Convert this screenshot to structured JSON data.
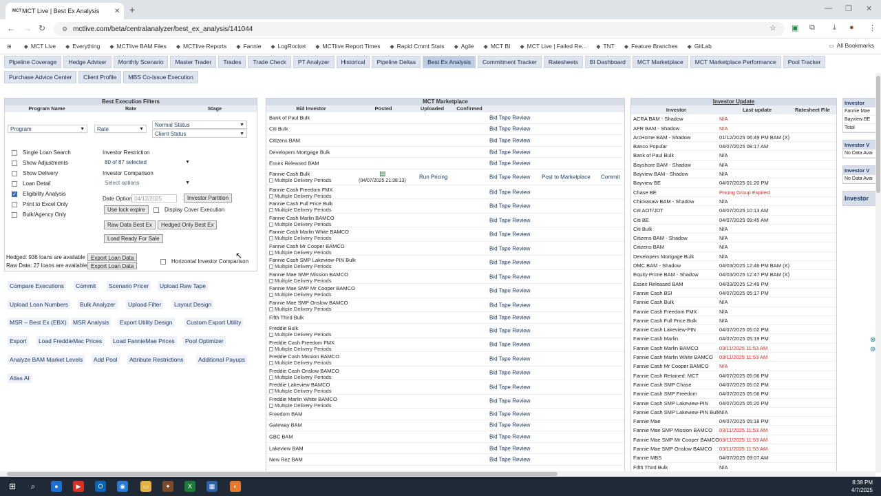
{
  "browser": {
    "tab_title": "MCT Live | Best Ex Analysis",
    "tab_favicon": "MCT",
    "url": "mctlive.com/beta/centralanalyzer/best_ex_analysis/141044",
    "all_bookmarks": "All Bookmarks"
  },
  "bookmarks": [
    {
      "label": "MCT Live",
      "icon": "mct-icon"
    },
    {
      "label": "Everything",
      "icon": "cart-icon"
    },
    {
      "label": "MCTlive BAM Files",
      "icon": "gdrive-icon"
    },
    {
      "label": "MCTlive Reports",
      "icon": "github-icon"
    },
    {
      "label": "Fannie",
      "icon": "globe-icon"
    },
    {
      "label": "LogRocket",
      "icon": "logrocket-icon"
    },
    {
      "label": "MCTlive Report Times",
      "icon": "mct-icon"
    },
    {
      "label": "Rapid Cmmt Stats",
      "icon": "mct-icon"
    },
    {
      "label": "Agile",
      "icon": "github-icon"
    },
    {
      "label": "MCT BI",
      "icon": "bi-icon"
    },
    {
      "label": "MCT Live | Failed Re...",
      "icon": "mct-icon"
    },
    {
      "label": "TNT",
      "icon": "tnt-icon"
    },
    {
      "label": "Feature Branches",
      "icon": "folder-icon"
    },
    {
      "label": "GitLab",
      "icon": "gitlab-icon"
    }
  ],
  "nav": {
    "row1": [
      "Pipeline Coverage",
      "Hedge Adviser",
      "Monthly Scenario",
      "Master Trader",
      "Trades",
      "Trade Check",
      "PT Analyzer",
      "Historical",
      "Pipeline Deltas",
      "Best Ex Analysis",
      "Commitment Tracker",
      "Ratesheets",
      "BI Dashboard",
      "MCT Marketplace",
      "MCT Marketplace Performance",
      "Pool Tracker"
    ],
    "row2": [
      "Purchase Advice Center",
      "Client Profile",
      "MBS Co-Issue Execution"
    ],
    "active": "Best Ex Analysis"
  },
  "filters": {
    "title": "Best Execution Filters",
    "columns": [
      "Program Name",
      "Rate",
      "Stage"
    ],
    "program": "Program",
    "rate": "Rate",
    "stage1": "Normal Status",
    "stage2": "Client Status",
    "checkboxes": [
      {
        "label": "Single Loan Search",
        "checked": false
      },
      {
        "label": "Show Adjustments",
        "checked": false
      },
      {
        "label": "Show Delivery",
        "checked": false
      },
      {
        "label": "Loan Detail",
        "checked": false
      },
      {
        "label": "Eligibility Analysis",
        "checked": true
      },
      {
        "label": "Print to Excel Only",
        "checked": false
      },
      {
        "label": "Bulk/Agency Only",
        "checked": false
      }
    ],
    "investor_restriction_label": "Investor Restriction",
    "investor_restriction_value": "80 of 87 selected",
    "investor_comparison_label": "Investor Comparison",
    "investor_comparison_placeholder": "Select options",
    "date_option_label": "Date Option",
    "date_value": "04/12/2025",
    "investor_partition": "Investor Partition",
    "use_lock_expire": "Use lock expire",
    "display_cover_execution": "Display Cover Execution",
    "raw_data_best_ex": "Raw Data Best Ex",
    "hedged_only_best_ex": "Hedged Only Best Ex",
    "load_ready_for_sale": "Load Ready For Sale",
    "hedged_text": "Hedged: 936 loans are available",
    "raw_text": "Raw Data: 27 loans are available",
    "export_loan_data": "Export Loan Data",
    "horizontal_comparison": "Horizontal Investor Comparison"
  },
  "actions": [
    [
      "Compare Executions",
      "Commit",
      "Scenario Pricer",
      "Upload Raw Tape"
    ],
    [
      "Upload Loan Numbers",
      "Bulk Analyzer",
      "Upload Filter",
      "Layout Design"
    ],
    [
      "MSR – Best Ex (EBX)",
      "MSR Analysis",
      "Export Utility Design",
      "Custom Export Utility"
    ],
    [
      "Export",
      "Load FreddieMac Prices",
      "Load FannieMae Prices",
      "Pool Optimizer"
    ],
    [
      "Analyze BAM Market Levels",
      "Add Pool",
      "Attribute Restrictions",
      "Additional Payups"
    ],
    [
      "Atlas AI"
    ]
  ],
  "marketplace": {
    "title": "MCT Marketplace",
    "columns": [
      "Bid Investor",
      "Posted",
      "Uploaded",
      "Confirmed"
    ],
    "review_label": "Bid Tape Review",
    "multi_label": "Multiple Delivery Periods",
    "run_pricing": "Run Pricing",
    "post_to_marketplace": "Post to Marketplace",
    "commit": "Commit",
    "uploaded_time": "(04/07/2025 21:38:13)",
    "rows": [
      {
        "name": "Bank of Paul Bulk",
        "multi": false
      },
      {
        "name": "Citi Bulk",
        "multi": false
      },
      {
        "name": "Citizens BAM",
        "multi": false
      },
      {
        "name": "Developers Mortgage Bulk",
        "multi": false
      },
      {
        "name": "Essex Released BAM",
        "multi": false
      },
      {
        "name": "Fannie Cash Bulk",
        "multi": true,
        "special": true
      },
      {
        "name": "Fannie Cash Freedom FMX",
        "multi": true
      },
      {
        "name": "Fannie Cash Full Price Bulk",
        "multi": true
      },
      {
        "name": "Fannie Cash Marlin BAMCO",
        "multi": true
      },
      {
        "name": "Fannie Cash Marlin White BAMCO",
        "multi": true
      },
      {
        "name": "Fannie Cash Mr Cooper BAMCO",
        "multi": true
      },
      {
        "name": "Fannie Cash SMP Lakeview-PIN Bulk",
        "multi": true
      },
      {
        "name": "Fannie Mae SMP Mission BAMCO",
        "multi": true
      },
      {
        "name": "Fannie Mae SMP Mr Cooper BAMCO",
        "multi": true
      },
      {
        "name": "Fannie Mae SMP Onslow BAMCO",
        "multi": true
      },
      {
        "name": "Fifth Third Bulk",
        "multi": false
      },
      {
        "name": "Freddie Bulk",
        "multi": true
      },
      {
        "name": "Freddie Cash Freedom FMX",
        "multi": true
      },
      {
        "name": "Freddie Cash Mission BAMCO",
        "multi": true
      },
      {
        "name": "Freddie Cash Onslow BAMCO",
        "multi": true
      },
      {
        "name": "Freddie Lakeview BAMCO",
        "multi": true
      },
      {
        "name": "Freddie Marlin White BAMCO",
        "multi": true
      },
      {
        "name": "Freedom BAM",
        "multi": false
      },
      {
        "name": "Gateway BAM",
        "multi": false
      },
      {
        "name": "GBC BAM",
        "multi": false
      },
      {
        "name": "Lakeview BAM",
        "multi": false
      },
      {
        "name": "New Rez BAM",
        "multi": false
      }
    ]
  },
  "investor_update": {
    "title": "Investor Update",
    "columns": [
      "Investor",
      "Last update",
      "Ratesheet File"
    ],
    "rows": [
      {
        "inv": "ACRA BAM - Shadow",
        "upd": "N/A",
        "red": true
      },
      {
        "inv": "AFR BAM - Shadow",
        "upd": "N/A",
        "red": true
      },
      {
        "inv": "ArcHome BAM - Shadow",
        "upd": "01/12/2025 06:49 PM BAM (X)",
        "red": false
      },
      {
        "inv": "Banco Popular",
        "upd": "04/07/2025 08:17 AM",
        "red": false
      },
      {
        "inv": "Bank of Paul Bulk",
        "upd": "N/A",
        "red": false
      },
      {
        "inv": "Bayshore BAM - Shadow",
        "upd": "N/A",
        "red": false
      },
      {
        "inv": "Bayview BAM - Shadow",
        "upd": "N/A",
        "red": false
      },
      {
        "inv": "Bayview BE",
        "upd": "04/07/2025 01:20 PM",
        "red": false
      },
      {
        "inv": "Chase BE",
        "upd": "Pricing Group Expired",
        "red": true
      },
      {
        "inv": "Chickasaw BAM - Shadow",
        "upd": "N/A",
        "red": false
      },
      {
        "inv": "Citi AOT/JDT",
        "upd": "04/07/2025 10:13 AM",
        "red": false
      },
      {
        "inv": "Citi BE",
        "upd": "04/07/2025 09:45 AM",
        "red": false
      },
      {
        "inv": "Citi Bulk",
        "upd": "N/A",
        "red": false
      },
      {
        "inv": "Citizens BAM - Shadow",
        "upd": "N/A",
        "red": false
      },
      {
        "inv": "Citizens BAM",
        "upd": "N/A",
        "red": false
      },
      {
        "inv": "Developers Mortgage Bulk",
        "upd": "N/A",
        "red": false
      },
      {
        "inv": "DMC BAM - Shadow",
        "upd": "04/03/2025 12:46 PM BAM (X)",
        "red": false
      },
      {
        "inv": "Equity Prime BAM - Shadow",
        "upd": "04/03/2025 12:47 PM BAM (X)",
        "red": false
      },
      {
        "inv": "Essex Released BAM",
        "upd": "04/03/2025 12:49 PM",
        "red": false
      },
      {
        "inv": "Fannie Cash BSI",
        "upd": "04/07/2025 05:17 PM",
        "red": false
      },
      {
        "inv": "Fannie Cash Bulk",
        "upd": "N/A",
        "red": false
      },
      {
        "inv": "Fannie Cash Freedom FMX",
        "upd": "N/A",
        "red": false
      },
      {
        "inv": "Fannie Cash Full Price Bulk",
        "upd": "N/A",
        "red": false
      },
      {
        "inv": "Fannie Cash Lakeview-PIN",
        "upd": "04/07/2025 05:02 PM",
        "red": false
      },
      {
        "inv": "Fannie Cash Marlin",
        "upd": "04/07/2025 05:19 PM",
        "red": false
      },
      {
        "inv": "Fannie Cash Marlin BAMCO",
        "upd": "03/11/2025 11:53 AM",
        "red": true
      },
      {
        "inv": "Fannie Cash Marlin White BAMCO",
        "upd": "03/11/2025 11:53 AM",
        "red": true
      },
      {
        "inv": "Fannie Cash Mr Cooper BAMCO",
        "upd": "N/A",
        "red": true
      },
      {
        "inv": "Fannie Cash Retained: MCT",
        "upd": "04/07/2025 05:06 PM",
        "red": false
      },
      {
        "inv": "Fannie Cash SMP Chase",
        "upd": "04/07/2025 05:02 PM",
        "red": false
      },
      {
        "inv": "Fannie Cash SMP Freedom",
        "upd": "04/07/2025 05:06 PM",
        "red": false
      },
      {
        "inv": "Fannie Cash SMP Lakeview-PIN",
        "upd": "04/07/2025 05:20 PM",
        "red": false
      },
      {
        "inv": "Fannie Cash SMP Lakeview-PIN Bulk",
        "upd": "N/A",
        "red": false
      },
      {
        "inv": "Fannie Mae",
        "upd": "04/07/2025 05:18 PM",
        "red": false
      },
      {
        "inv": "Fannie Mae SMP Mission BAMCO",
        "upd": "03/11/2025 11:53 AM",
        "red": true
      },
      {
        "inv": "Fannie Mae SMP Mr Cooper BAMCO",
        "upd": "03/11/2025 11:53 AM",
        "red": true
      },
      {
        "inv": "Fannie Mae SMP Onslow BAMCO",
        "upd": "03/11/2025 11:53 AM",
        "red": true
      },
      {
        "inv": "Fannie MBS",
        "upd": "04/07/2025 09:07 AM",
        "red": false
      },
      {
        "inv": "Fifth Third Bulk",
        "upd": "N/A",
        "red": false
      }
    ]
  },
  "right_strip": {
    "box1_head": "Investor",
    "box1_cells": [
      "Fannie Mae",
      "Bayview BE",
      "Total"
    ],
    "box2_head": "Investor V",
    "box2_cell": "No Data Avai",
    "box3_head": "Investor V",
    "box3_cell": "No Data Avai",
    "box4_head": "Investor"
  },
  "taskbar": {
    "time": "8:38 PM",
    "date": "4/7/2025"
  },
  "colors": {
    "accent": "#1c3966",
    "nav_bg": "#dde4ee",
    "error_red": "#e0261e"
  }
}
